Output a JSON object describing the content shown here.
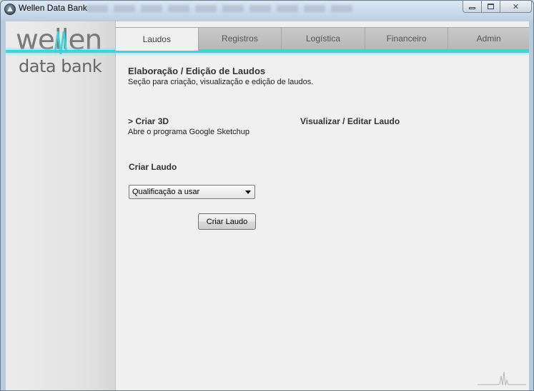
{
  "window": {
    "title": "Wellen Data Bank"
  },
  "logo": {
    "top": "wellen",
    "bottom": "data bank"
  },
  "tabs": [
    {
      "label": "Laudos",
      "active": true
    },
    {
      "label": "Registros",
      "active": false
    },
    {
      "label": "Logística",
      "active": false
    },
    {
      "label": "Financeiro",
      "active": false
    },
    {
      "label": "Admin",
      "active": false
    }
  ],
  "section": {
    "title": "Elaboração / Edição de Laudos",
    "subtitle": "Seção para criação, visualização e edição de laudos."
  },
  "criar3d": {
    "title": "> Criar 3D",
    "subtitle": "Abre o programa Google Sketchup"
  },
  "visualizar": {
    "title": "Visualizar / Editar Laudo"
  },
  "criar_laudo": {
    "title": "Criar Laudo",
    "select_value": "Qualificação a usar",
    "button_label": "Criar Laudo"
  },
  "colors": {
    "accent": "#3fd3da",
    "tab_bg": "#bdbdbd",
    "sidebar_bg": "#e4e4e4"
  }
}
